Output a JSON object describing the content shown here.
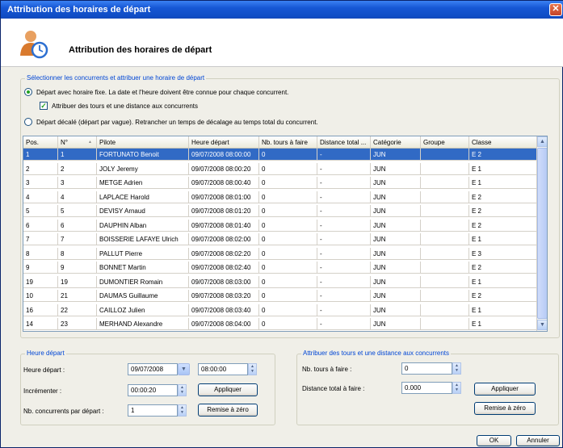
{
  "window": {
    "title": "Attribution des horaires de départ",
    "close_glyph": "✕"
  },
  "header": {
    "title": "Attribution des horaires de départ",
    "icon": "user-clock-icon"
  },
  "selection": {
    "legend": "Sélectionner les concurrents et attribuer une horaire de départ",
    "opt_fixed": "Départ avec horaire fixe. La date et l'heure doivent être connue pour chaque concurrent.",
    "opt_tours": "Attribuer des tours et une distance aux concurrents",
    "opt_offset": "Départ décalé (départ par vague). Retrancher un temps de décalage au temps total du concurrent.",
    "check_mark": "✓"
  },
  "grid": {
    "columns": [
      "Pos.",
      "N°",
      "Pilote",
      "Heure départ",
      "Nb. tours à faire",
      "Distance total ...",
      "Catégorie",
      "Groupe",
      "Classe"
    ],
    "sort_arrow": "▲",
    "rows": [
      [
        "1",
        "1",
        "FORTUNATO Benoit",
        "09/07/2008 08:00:00",
        "0",
        "-",
        "JUN",
        "",
        "E 2"
      ],
      [
        "2",
        "2",
        "JOLY Jeremy",
        "09/07/2008 08:00:20",
        "0",
        "-",
        "JUN",
        "",
        "E 1"
      ],
      [
        "3",
        "3",
        "METGE Adrien",
        "09/07/2008 08:00:40",
        "0",
        "-",
        "JUN",
        "",
        "E 1"
      ],
      [
        "4",
        "4",
        "LAPLACE Harold",
        "09/07/2008 08:01:00",
        "0",
        "-",
        "JUN",
        "",
        "E 2"
      ],
      [
        "5",
        "5",
        "DEVISY Arnaud",
        "09/07/2008 08:01:20",
        "0",
        "-",
        "JUN",
        "",
        "E 2"
      ],
      [
        "6",
        "6",
        "DAUPHIN Alban",
        "09/07/2008 08:01:40",
        "0",
        "-",
        "JUN",
        "",
        "E 2"
      ],
      [
        "7",
        "7",
        "BOISSERIE LAFAYE Ulrich",
        "09/07/2008 08:02:00",
        "0",
        "-",
        "JUN",
        "",
        "E 1"
      ],
      [
        "8",
        "8",
        "PALLUT Pierre",
        "09/07/2008 08:02:20",
        "0",
        "-",
        "JUN",
        "",
        "E 3"
      ],
      [
        "9",
        "9",
        "BONNET Martin",
        "09/07/2008 08:02:40",
        "0",
        "-",
        "JUN",
        "",
        "E 2"
      ],
      [
        "19",
        "19",
        "DUMONTIER Romain",
        "09/07/2008 08:03:00",
        "0",
        "-",
        "JUN",
        "",
        "E 1"
      ],
      [
        "10",
        "21",
        "DAUMAS Guillaume",
        "09/07/2008 08:03:20",
        "0",
        "-",
        "JUN",
        "",
        "E 2"
      ],
      [
        "16",
        "22",
        "CAILLOZ Julien",
        "09/07/2008 08:03:40",
        "0",
        "-",
        "JUN",
        "",
        "E 1"
      ],
      [
        "14",
        "23",
        "MERHAND Alexandre",
        "09/07/2008 08:04:00",
        "0",
        "-",
        "JUN",
        "",
        "E 1"
      ],
      [
        "",
        "",
        "",
        "",
        "",
        "",
        "",
        "",
        ""
      ]
    ],
    "selected_row": 0,
    "scroll_up": "▲",
    "scroll_down": "▼"
  },
  "depart": {
    "legend": "Heure départ",
    "heure_label": "Heure départ :",
    "date_value": "09/07/2008",
    "time_value": "08:00:00",
    "increment_label": "Incrémenter :",
    "increment_value": "00:00:20",
    "apply_label": "Appliquer",
    "nb_label": "Nb. concurrents par départ :",
    "nb_value": "1",
    "reset_label": "Remise à zéro"
  },
  "tours": {
    "legend": "Attribuer des tours et une distance aux concurrents",
    "nb_label": "Nb. tours à faire :",
    "nb_value": "0",
    "dist_label": "Distance total à faire :",
    "dist_value": "0.000",
    "apply_label": "Appliquer",
    "reset_label": "Remise à zéro"
  },
  "footer": {
    "ok_label": "OK",
    "cancel_label": "Annuler"
  }
}
